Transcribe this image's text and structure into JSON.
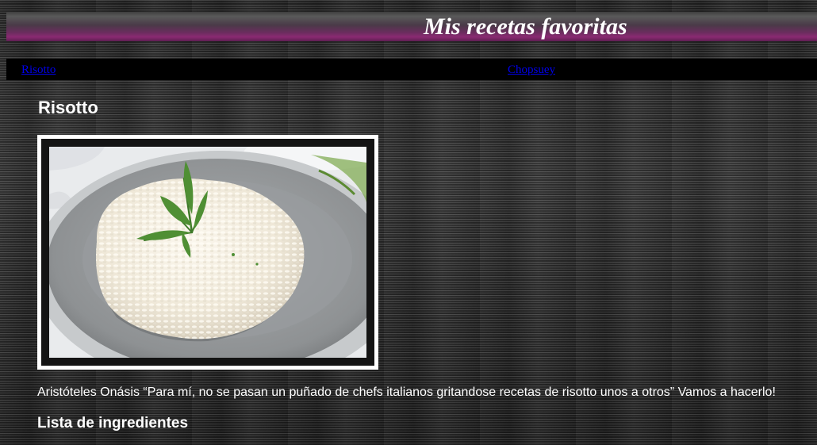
{
  "header": {
    "title": "Mis recetas favoritas",
    "accent_color": "#8a2a72"
  },
  "nav": {
    "links": [
      {
        "label": "Risotto"
      },
      {
        "label": "Chopsuey"
      }
    ],
    "link_color": "#0000ee"
  },
  "recipe": {
    "title": "Risotto",
    "image_icon": "risotto-photo",
    "quote": "Aristóteles Onásis “Para mí, no se pasan un puñado de chefs italianos gritandose recetas de risotto unos a otros” Vamos a hacerlo!",
    "ingredients_heading": "Lista de ingredientes"
  }
}
